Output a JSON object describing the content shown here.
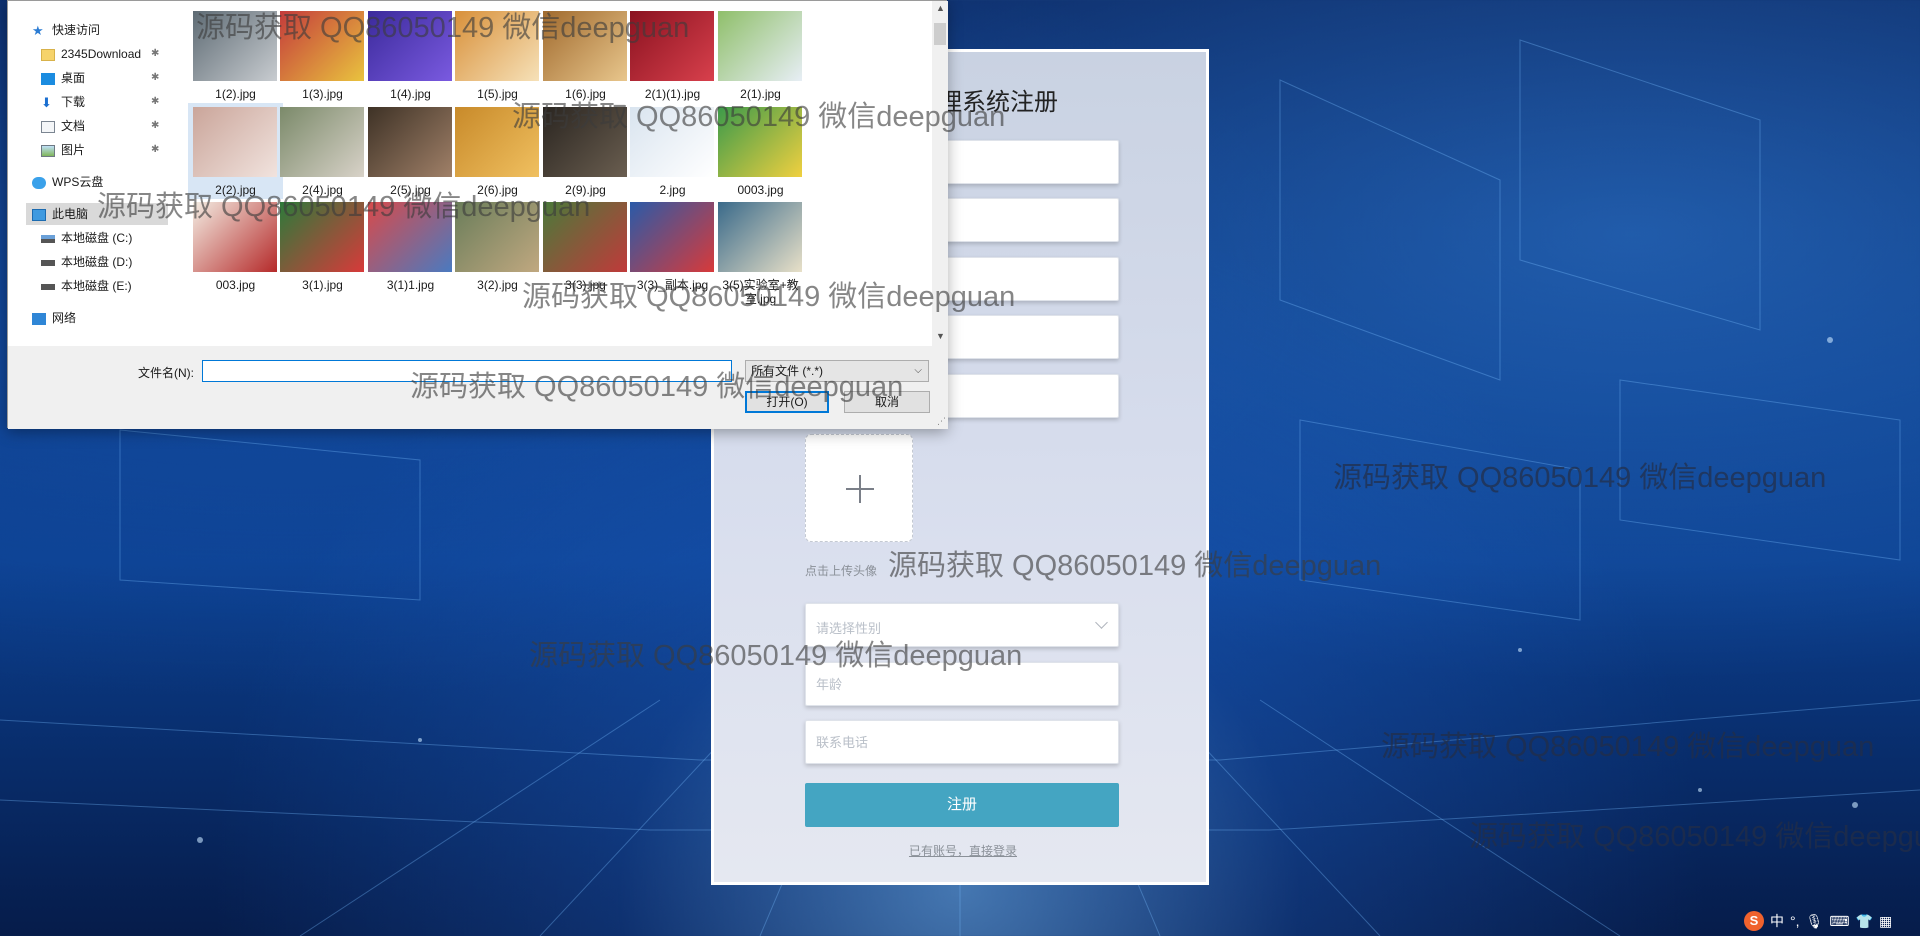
{
  "register": {
    "title": "理系统注册",
    "upload_label": "点击上传头像",
    "gender_placeholder": "请选择性别",
    "age_placeholder": "年龄",
    "phone_placeholder": "联系电话",
    "submit_label": "注册",
    "login_link": "已有账号，直接登录"
  },
  "dialog": {
    "nav": {
      "quick_access": "快速访问",
      "folder_2345": "2345Download",
      "desktop": "桌面",
      "downloads": "下载",
      "documents": "文档",
      "pictures": "图片",
      "wps_cloud": "WPS云盘",
      "this_pc": "此电脑",
      "drive_c": "本地磁盘 (C:)",
      "drive_d": "本地磁盘 (D:)",
      "drive_e": "本地磁盘 (E:)",
      "network": "网络"
    },
    "files": [
      {
        "name": "1(2).jpg"
      },
      {
        "name": "1(3).jpg"
      },
      {
        "name": "1(4).jpg"
      },
      {
        "name": "1(5).jpg"
      },
      {
        "name": "1(6).jpg"
      },
      {
        "name": "2(1)(1).jpg"
      },
      {
        "name": "2(1).jpg"
      },
      {
        "name": "2(2).jpg"
      },
      {
        "name": "2(4).jpg"
      },
      {
        "name": "2(5).jpg"
      },
      {
        "name": "2(6).jpg"
      },
      {
        "name": "2(9).jpg"
      },
      {
        "name": "2.jpg"
      },
      {
        "name": "0003.jpg"
      },
      {
        "name": "003.jpg"
      },
      {
        "name": "3(1).jpg"
      },
      {
        "name": "3(1)1.jpg"
      },
      {
        "name": "3(2).jpg"
      },
      {
        "name": "3(3).jpg"
      },
      {
        "name": "3(3)_副本.jpg"
      },
      {
        "name": "3(5)实验室+教室.jpg"
      }
    ],
    "filename_label": "文件名(N):",
    "filename_value": "",
    "filetype": "所有文件 (*.*)",
    "open_label": "打开(O)",
    "cancel_label": "取消"
  },
  "watermark": "源码获取 QQ86050149 微信deepguan",
  "tray": {
    "ime": "中",
    "punct": "°,"
  },
  "colors": {
    "accent": "#44a5c2",
    "dialog_focus": "#0078d7",
    "sogou": "#f0622d"
  }
}
